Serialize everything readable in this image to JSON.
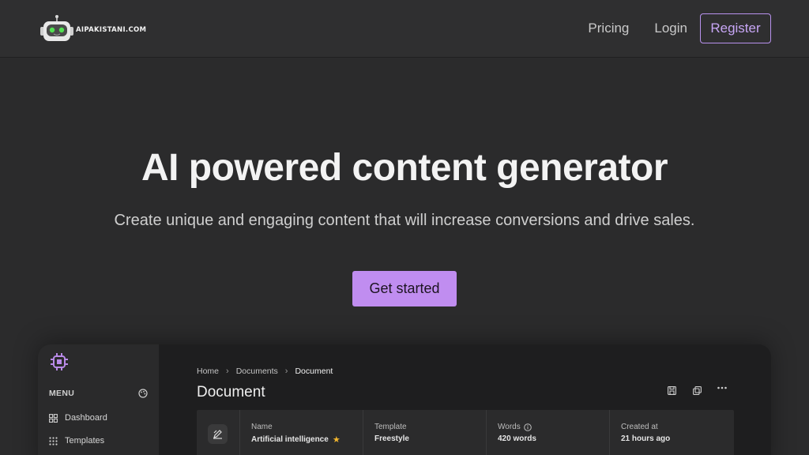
{
  "header": {
    "logo_text": "AIPAKISTANI.COM",
    "nav": {
      "pricing": "Pricing",
      "login": "Login",
      "register": "Register"
    }
  },
  "hero": {
    "title": "AI powered content generator",
    "subtitle": "Create unique and engaging content that will increase conversions and drive sales.",
    "cta": "Get started"
  },
  "preview": {
    "sidebar": {
      "menu_label": "MENU",
      "items": [
        {
          "label": "Dashboard",
          "icon": "dashboard-icon"
        },
        {
          "label": "Templates",
          "icon": "grid-icon"
        }
      ]
    },
    "breadcrumb": [
      "Home",
      "Documents",
      "Document"
    ],
    "title": "Document",
    "card": {
      "columns": [
        {
          "label": "Name",
          "value": "Artificial intelligence"
        },
        {
          "label": "Template",
          "value": "Freestyle"
        },
        {
          "label": "Words",
          "value": "420 words"
        },
        {
          "label": "Created at",
          "value": "21 hours ago"
        }
      ]
    }
  },
  "colors": {
    "background": "#2b2b2c",
    "accent": "#c08df0",
    "register_border": "#b892ee",
    "star": "#f5b82e"
  }
}
